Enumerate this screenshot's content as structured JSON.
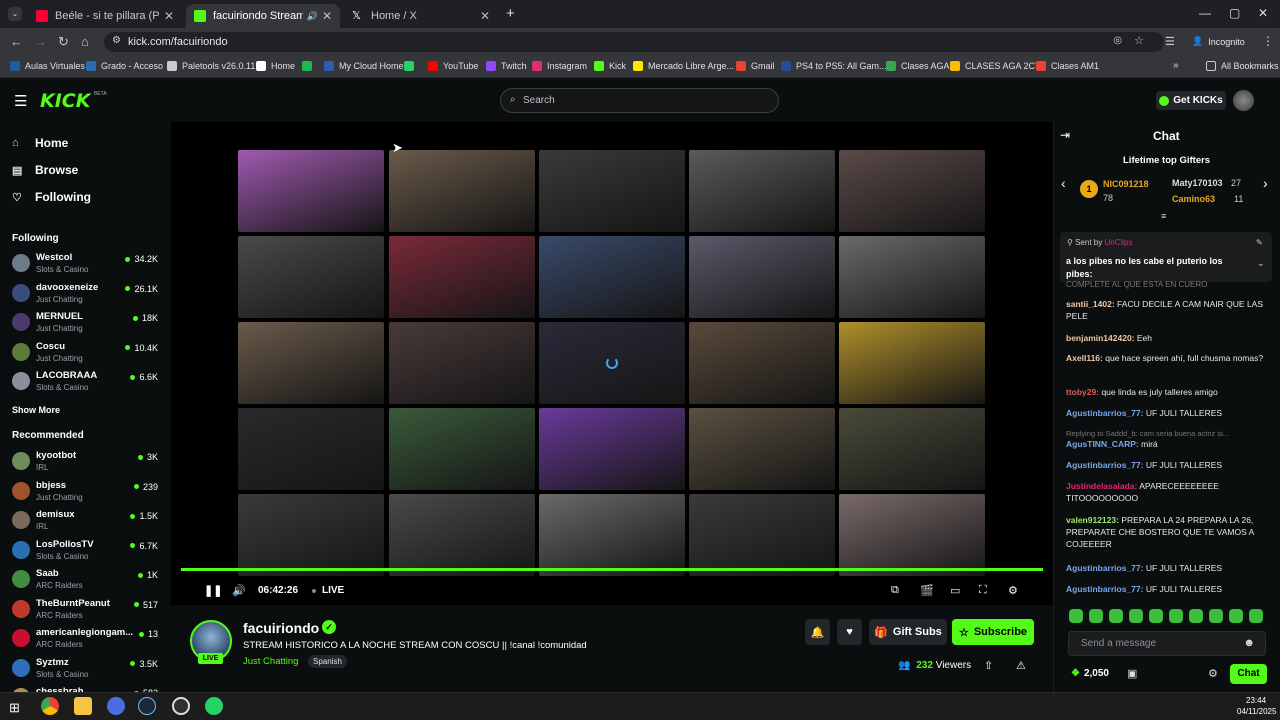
{
  "browser": {
    "tabs": [
      {
        "label": "Beéle - si te pillara (Performance",
        "active": false,
        "icon_color": "#ff0033"
      },
      {
        "label": "facuiriondo Stream - Watch",
        "active": true,
        "icon_color": "#53fc18"
      },
      {
        "label": "Home / X",
        "active": false,
        "icon_color": "#ffffff"
      }
    ],
    "url": "kick.com/facuiriondo",
    "incognito_label": "Incognito",
    "bookmarks": [
      {
        "label": "Aulas Virtuales",
        "color": "#1b5e9b"
      },
      {
        "label": "Grado - Acceso",
        "color": "#2b6cb0"
      },
      {
        "label": "Paletools v26.0.11",
        "color": "#cccccc"
      },
      {
        "label": "Home",
        "color": "#ffffff"
      },
      {
        "label": "",
        "color": "#1db954"
      },
      {
        "label": "My Cloud Home",
        "color": "#2a5db0"
      },
      {
        "label": "",
        "color": "#25d366"
      },
      {
        "label": "YouTube",
        "color": "#ff0000"
      },
      {
        "label": "Twitch",
        "color": "#9146ff"
      },
      {
        "label": "Instagram",
        "color": "#e1306c"
      },
      {
        "label": "Kick",
        "color": "#53fc18"
      },
      {
        "label": "Mercado Libre Arge...",
        "color": "#ffe600"
      },
      {
        "label": "Gmail",
        "color": "#ea4335"
      },
      {
        "label": "PS4 to PS5: All Gam...",
        "color": "#2a4b9b"
      },
      {
        "label": "Clases AGA",
        "color": "#34a853"
      },
      {
        "label": "CLASES AGA 2CT",
        "color": "#fbbc04"
      },
      {
        "label": "Clases AM1",
        "color": "#ea4335"
      }
    ],
    "all_bookmarks": "All Bookmarks"
  },
  "kick": {
    "logo": "KICK",
    "search_placeholder": "Search",
    "get_kicks": "Get KICKs"
  },
  "sidebar": {
    "nav": [
      {
        "label": "Home",
        "icon": "home-icon"
      },
      {
        "label": "Browse",
        "icon": "browse-icon"
      },
      {
        "label": "Following",
        "icon": "heart-icon"
      }
    ],
    "following_header": "Following",
    "following": [
      {
        "name": "Westcol",
        "category": "Slots & Casino",
        "viewers": "34.2K",
        "color": "#6c7a89"
      },
      {
        "name": "davooxeneize",
        "category": "Just Chatting",
        "viewers": "26.1K",
        "color": "#3b4d7a"
      },
      {
        "name": "MERNUEL",
        "category": "Just Chatting",
        "viewers": "18K",
        "color": "#4b3a6e"
      },
      {
        "name": "Coscu",
        "category": "Just Chatting",
        "viewers": "10.4K",
        "color": "#5a7d3a"
      },
      {
        "name": "LACOBRAAA",
        "category": "Slots & Casino",
        "viewers": "6.6K",
        "color": "#8a8fa0"
      }
    ],
    "show_more": "Show More",
    "recommended_header": "Recommended",
    "recommended": [
      {
        "name": "kyootbot",
        "category": "IRL",
        "viewers": "3K",
        "color": "#6b8e5a"
      },
      {
        "name": "bbjess",
        "category": "Just Chatting",
        "viewers": "239",
        "color": "#a0522d"
      },
      {
        "name": "demisux",
        "category": "IRL",
        "viewers": "1.5K",
        "color": "#7a6a5a"
      },
      {
        "name": "LosPollosTV",
        "category": "Slots & Casino",
        "viewers": "6.7K",
        "color": "#2a6fb0"
      },
      {
        "name": "Saab",
        "category": "ARC Raiders",
        "viewers": "1K",
        "color": "#3f8f3f"
      },
      {
        "name": "TheBurntPeanut",
        "category": "ARC Raiders",
        "viewers": "517",
        "color": "#c0392b"
      },
      {
        "name": "americanlegiongam...",
        "category": "ARC Raiders",
        "viewers": "13",
        "color": "#c8102e"
      },
      {
        "name": "Syztmz",
        "category": "Slots & Casino",
        "viewers": "3.5K",
        "color": "#2c6fbb"
      },
      {
        "name": "chessbrah",
        "category": "",
        "viewers": "582",
        "color": "#b08d57"
      }
    ]
  },
  "player": {
    "time": "06:42:26",
    "live": "LIVE",
    "progress": 1.0
  },
  "stream": {
    "channel": "facuiriondo",
    "live_badge": "LIVE",
    "title": "STREAM HISTORICO A LA NOCHE STREAM CON COSCU || !canal !comunidad",
    "category": "Just Chatting",
    "language": "Spanish",
    "gift_subs": "Gift Subs",
    "subscribe": "Subscribe",
    "viewers_count": "232",
    "viewers_label": "Viewers"
  },
  "chat": {
    "title": "Chat",
    "top_gifters_title": "Lifetime top Gifters",
    "gifters": [
      {
        "rank": "1",
        "name": "NIC091218",
        "amount": "78"
      },
      {
        "rank": "",
        "name": "Maty170103",
        "amount": "27"
      },
      {
        "rank": "",
        "name": "Camino63",
        "amount": "11"
      }
    ],
    "pinned_sent_by": "Sent by",
    "pinned_user": "UnClips",
    "pinned_text": "a los pibes no les cabe el puterio los pibes:",
    "faded_text": "COMPLETE AL QUE ESTA EN CUERO",
    "messages": [
      {
        "user": "santii_1402:",
        "text": "FACU DECILE A CAM NAIR QUE LAS PELE",
        "color": "#f0c7a0"
      },
      {
        "user": "benjamin142420:",
        "text": "Eeh",
        "color": "#f0c7a0"
      },
      {
        "user": "Axell116:",
        "text": "que hace spreen ahí, full chusma nomas?",
        "color": "#f0c7a0"
      },
      {
        "user": "ttoby29:",
        "text": "que linda es july talleres amigo",
        "color": "#e05a5a"
      },
      {
        "user": "Agustinbarrios_77:",
        "text": "UF JULI TALLERES",
        "color": "#7aa7e8"
      },
      {
        "user": "AgusTINN_CARP:",
        "text": "mirá",
        "color": "#7aa7e8"
      },
      {
        "user": "Agustinbarrios_77:",
        "text": "UF JULI TALLERES",
        "color": "#7aa7e8"
      },
      {
        "user": "Justindelasalada:",
        "text": "APARECEEEEEEEE TITOOOOOOOOO",
        "color": "#e0266e"
      },
      {
        "user": "valen912123:",
        "text": "PREPARA LA 24 PREPARA LA 26, PREPARATE CHE BOSTERO QUE TE VAMOS A COJEEEER",
        "color": "#9ee86a"
      },
      {
        "user": "Agustinbarrios_77:",
        "text": "UF JULI TALLERES",
        "color": "#7aa7e8"
      },
      {
        "user": "Agustinbarrios_77:",
        "text": "UF JULI TALLERES",
        "color": "#7aa7e8"
      }
    ],
    "reply_label": "Replying to Saddd_b: cam seria buena actriz si...",
    "message_placeholder": "Send a message",
    "points": "2,050",
    "chat_button": "Chat"
  },
  "taskbar": {
    "time": "23:44",
    "date": "04/11/2025"
  }
}
